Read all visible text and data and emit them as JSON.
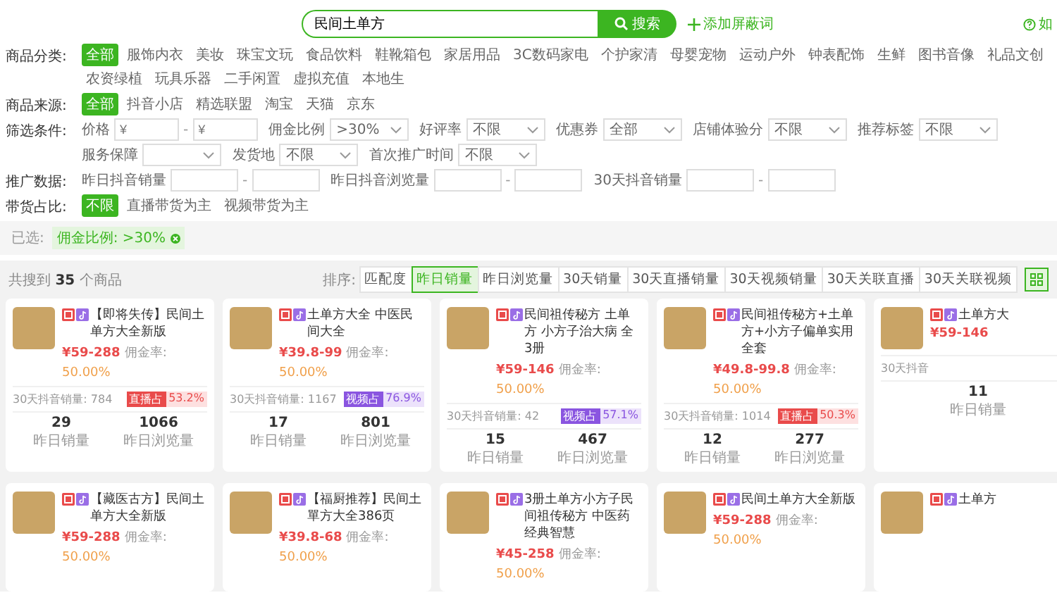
{
  "search": {
    "value": "民间土单方",
    "button": "搜索",
    "add_link": "添加屏蔽词",
    "help": "如"
  },
  "categories": {
    "label": "商品分类:",
    "items": [
      {
        "label": "全部",
        "selected": true
      },
      {
        "label": "服饰内衣",
        "selected": false
      },
      {
        "label": "美妆",
        "selected": false
      },
      {
        "label": "珠宝文玩",
        "selected": false
      },
      {
        "label": "食品饮料",
        "selected": false
      },
      {
        "label": "鞋靴箱包",
        "selected": false
      },
      {
        "label": "家居用品",
        "selected": false
      },
      {
        "label": "3C数码家电",
        "selected": false
      },
      {
        "label": "个护家清",
        "selected": false
      },
      {
        "label": "母婴宠物",
        "selected": false
      },
      {
        "label": "运动户外",
        "selected": false
      },
      {
        "label": "钟表配饰",
        "selected": false
      },
      {
        "label": "生鲜",
        "selected": false
      },
      {
        "label": "图书音像",
        "selected": false
      },
      {
        "label": "礼品文创",
        "selected": false
      },
      {
        "label": "农资绿植",
        "selected": false
      },
      {
        "label": "玩具乐器",
        "selected": false
      },
      {
        "label": "二手闲置",
        "selected": false
      },
      {
        "label": "虚拟充值",
        "selected": false
      },
      {
        "label": "本地生",
        "selected": false
      }
    ]
  },
  "sources": {
    "label": "商品来源:",
    "items": [
      {
        "label": "全部",
        "selected": true
      },
      {
        "label": "抖音小店",
        "selected": false
      },
      {
        "label": "精选联盟",
        "selected": false
      },
      {
        "label": "淘宝",
        "selected": false
      },
      {
        "label": "天猫",
        "selected": false
      },
      {
        "label": "京东",
        "selected": false
      }
    ]
  },
  "filters": {
    "label": "筛选条件:",
    "items": [
      {
        "kind": "range",
        "label": "价格",
        "placeholder": "¥",
        "separator": "-"
      },
      {
        "kind": "select",
        "label": "佣金比例",
        "value": ">30%"
      },
      {
        "kind": "select",
        "label": "好评率",
        "value": "不限"
      },
      {
        "kind": "select",
        "label": "优惠券",
        "value": "全部"
      },
      {
        "kind": "select",
        "label": "店铺体验分",
        "value": "不限"
      },
      {
        "kind": "select",
        "label": "推荐标签",
        "value": "不限"
      },
      {
        "kind": "select",
        "label": "服务保障"
      },
      {
        "kind": "select",
        "label": "发货地",
        "value": "不限"
      },
      {
        "kind": "select",
        "label": "首次推广时间",
        "value": "不限"
      }
    ]
  },
  "promo_data": {
    "label": "推广数据:",
    "items": [
      {
        "label": "昨日抖音销量",
        "separator": "-"
      },
      {
        "label": "昨日抖音浏览量",
        "separator": "-"
      },
      {
        "label": "30天抖音销量",
        "separator": "-"
      }
    ]
  },
  "share": {
    "label": "带货占比:",
    "items": [
      {
        "label": "不限",
        "selected": true
      },
      {
        "label": "直播带货为主",
        "selected": false
      },
      {
        "label": "视频带货为主",
        "selected": false
      }
    ]
  },
  "selected_filters": {
    "label": "已选:",
    "tags": [
      "佣金比例: >30%"
    ]
  },
  "results": {
    "prefix": "共搜到",
    "count": "35",
    "suffix": "个商品"
  },
  "sort": {
    "label": "排序:",
    "items": [
      {
        "label": "匹配度",
        "selected": false
      },
      {
        "label": "昨日销量",
        "selected": true
      },
      {
        "label": "昨日浏览量",
        "selected": false
      },
      {
        "label": "30天销量",
        "selected": false
      },
      {
        "label": "30天直播销量",
        "selected": false
      },
      {
        "label": "30天视频销量",
        "selected": false
      },
      {
        "label": "30天关联直播",
        "selected": false
      },
      {
        "label": "30天关联视频",
        "selected": false
      }
    ]
  },
  "products": [
    {
      "title": "【即将失传】民间土单方大全新版",
      "price": "¥59-288",
      "commission_label": "佣金率:",
      "commission": "50.00%",
      "sales_30d": "30天抖音销量: 784",
      "tag": {
        "kind": "live",
        "label": "直播占",
        "value": "53.2%"
      },
      "stats": [
        {
          "value": "29",
          "label": "昨日销量"
        },
        {
          "value": "1066",
          "label": "昨日浏览量"
        }
      ]
    },
    {
      "title": "土单方大全 中医民间大全",
      "price": "¥39.8-99",
      "commission_label": "佣金率:",
      "commission": "50.00%",
      "sales_30d": "30天抖音销量: 1167",
      "tag": {
        "kind": "video",
        "label": "视频占",
        "value": "76.9%"
      },
      "stats": [
        {
          "value": "17",
          "label": "昨日销量"
        },
        {
          "value": "801",
          "label": "昨日浏览量"
        }
      ]
    },
    {
      "title": "民间祖传秘方 土单方 小方子治大病 全3册",
      "price": "¥59-146",
      "commission_label": "佣金率:",
      "commission": "50.00%",
      "sales_30d": "30天抖音销量: 42",
      "tag": {
        "kind": "video",
        "label": "视频占",
        "value": "57.1%"
      },
      "stats": [
        {
          "value": "15",
          "label": "昨日销量"
        },
        {
          "value": "467",
          "label": "昨日浏览量"
        }
      ]
    },
    {
      "title": "民间祖传秘方+土单方+小方子偏单实用全套",
      "price": "¥49.8-99.8",
      "commission_label": "佣金率:",
      "commission": "50.00%",
      "sales_30d": "30天抖音销量: 1014",
      "tag": {
        "kind": "live",
        "label": "直播占",
        "value": "50.3%"
      },
      "stats": [
        {
          "value": "12",
          "label": "昨日销量"
        },
        {
          "value": "277",
          "label": "昨日浏览量"
        }
      ]
    },
    {
      "title": "土单方大",
      "price": "¥59-146",
      "sales_30d": "30天抖音",
      "stats": [
        {
          "value": "11",
          "label": "昨日销量"
        }
      ]
    },
    {
      "title": "【藏医古方】民间土单方大全新版",
      "price": "¥59-288",
      "commission_label": "佣金率:",
      "commission": "50.00%"
    },
    {
      "title": "【福厨推荐】民间土單方大全386页",
      "price": "¥39.8-68",
      "commission_label": "佣金率:",
      "commission": "50.00%"
    },
    {
      "title": "3册土单方小方子民间祖传秘方 中医药经典智慧",
      "price": "¥45-258",
      "commission_label": "佣金率:",
      "commission": "50.00%"
    },
    {
      "title": "民间土单方大全新版",
      "price": "¥59-288",
      "commission_label": "佣金率:",
      "commission": "50.00%"
    },
    {
      "title": "土单方"
    }
  ]
}
